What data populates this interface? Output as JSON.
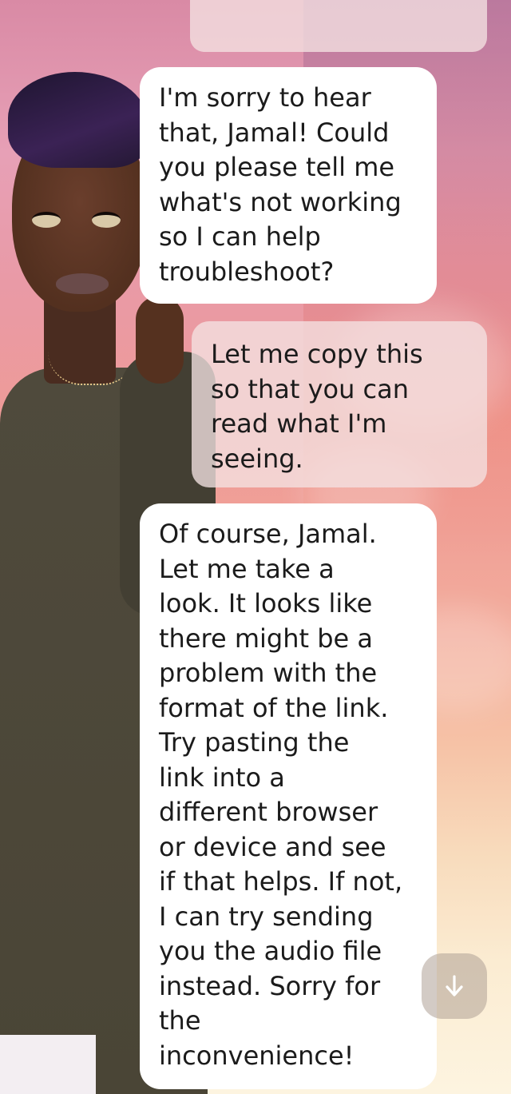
{
  "chat": {
    "messages": [
      {
        "sender": "ai",
        "text": "I'm sorry to hear\nthat, Jamal! Could\nyou please tell me\nwhat's not working\nso I can help\ntroubleshoot?"
      },
      {
        "sender": "user",
        "text": "Let me copy this\nso that you can\nread what I'm\nseeing."
      },
      {
        "sender": "ai",
        "text": "Of course, Jamal.\nLet me take a\nlook. It looks like\nthere might be a\nproblem with the\nformat of the link.\nTry pasting the\nlink into a\ndifferent browser\nor device and see\nif that helps. If not,\nI can try sending\nyou the audio file\ninstead. Sorry for\nthe\ninconvenience!"
      }
    ]
  },
  "controls": {
    "scroll_down_icon": "arrow-down-icon"
  }
}
